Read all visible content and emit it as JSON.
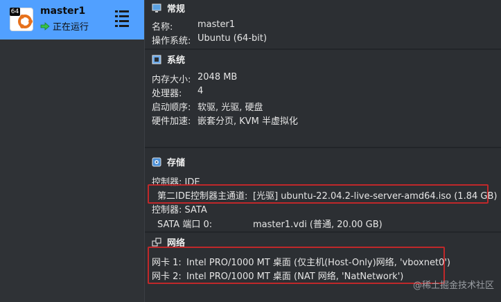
{
  "vm": {
    "badge": "64",
    "name": "master1",
    "state": "正在运行"
  },
  "general": {
    "title": "常规",
    "rows": [
      {
        "label": "名称:",
        "value": "master1"
      },
      {
        "label": "操作系统:",
        "value": "Ubuntu (64-bit)"
      }
    ]
  },
  "system": {
    "title": "系统",
    "rows": [
      {
        "label": "内存大小:",
        "value": "2048 MB"
      },
      {
        "label": "处理器:",
        "value": "4"
      },
      {
        "label": "启动顺序:",
        "value": "软驱, 光驱, 硬盘"
      },
      {
        "label": "硬件加速:",
        "value": "嵌套分页, KVM 半虚拟化"
      }
    ]
  },
  "storage": {
    "title": "存储",
    "controller_ide": "控制器: IDE",
    "ide_label": "第二IDE控制器主通道:",
    "ide_value": "[光驱] ubuntu-22.04.2-live-server-amd64.iso (1.84 GB)",
    "controller_sata": "控制器: SATA",
    "sata_label": "SATA 端口 0:",
    "sata_value": "master1.vdi (普通, 20.00 GB)"
  },
  "network": {
    "title": "网络",
    "adapters": [
      {
        "label": "网卡 1:",
        "value": "Intel PRO/1000 MT 桌面 (仅主机(Host-Only)网络, 'vboxnet0')"
      },
      {
        "label": "网卡 2:",
        "value": "Intel PRO/1000 MT 桌面 (NAT 网络, 'NatNetwork')"
      }
    ]
  },
  "watermark": "@稀土掘金技术社区",
  "colors": {
    "selection": "#51a0ff",
    "highlight_box": "#c0282a",
    "panel_bg": "#2c2f33"
  }
}
